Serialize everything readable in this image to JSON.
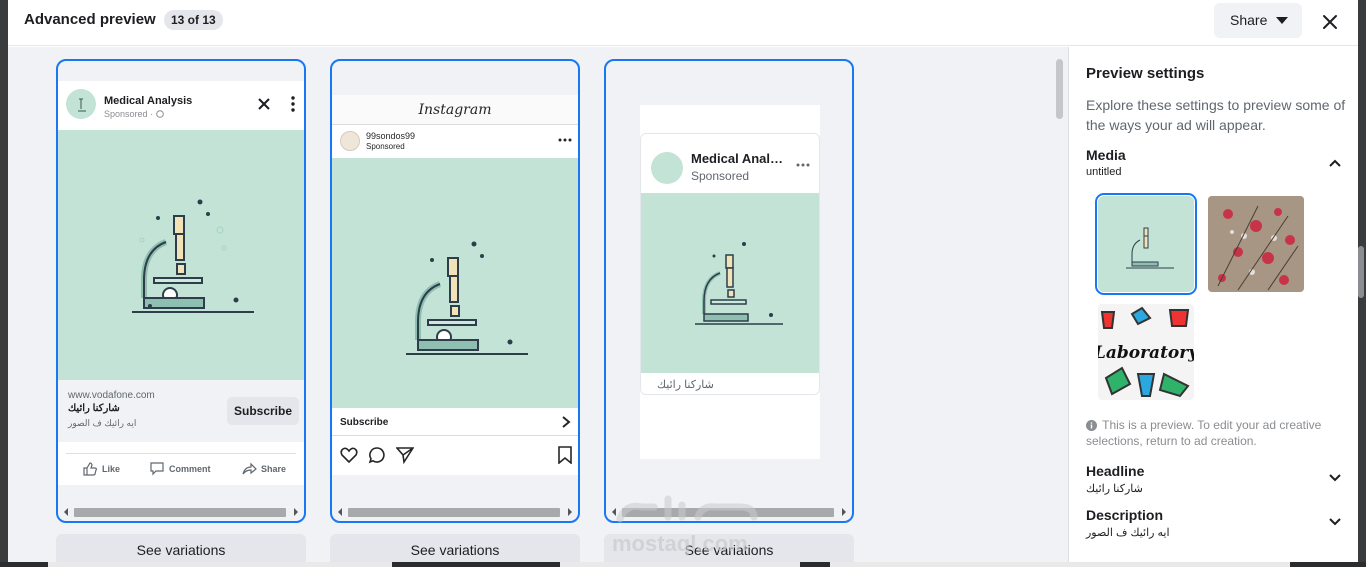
{
  "header": {
    "title": "Advanced preview",
    "count": "13 of 13",
    "share_label": "Share"
  },
  "previews": {
    "facebook": {
      "page_name": "Medical Analysis",
      "sponsored": "Sponsored ·",
      "url": "www.vodafone.com",
      "headline": "شاركنا رائيك",
      "description": "ايه رائيك ف الصور",
      "cta": "Subscribe",
      "actions": [
        "Like",
        "Comment",
        "Share"
      ]
    },
    "instagram": {
      "logo": "Instagram",
      "username": "99sondos99",
      "sponsored": "Sponsored",
      "cta": "Subscribe"
    },
    "messenger": {
      "page_name": "Medical Analysis",
      "sponsored": "Sponsored",
      "caption": "شاركنا رائيك"
    },
    "see_variations": "See variations",
    "watermark": "mostaql.com"
  },
  "settings": {
    "title": "Preview settings",
    "intro": "Explore these settings to preview some of the ways your ad will appear.",
    "media_label": "Media",
    "media_value": "untitled",
    "note": "This is a preview. To edit your ad creative selections, return to ad creation.",
    "headline_label": "Headline",
    "headline_value": "شاركنا رائيك",
    "description_label": "Description",
    "description_value": "ايه رائيك ف الصور",
    "thumb3_text": "Laboratory"
  },
  "colors": {
    "accent": "#1877f2",
    "media_bg": "#c2e3d5",
    "panel_bg": "#f0f2f5"
  }
}
